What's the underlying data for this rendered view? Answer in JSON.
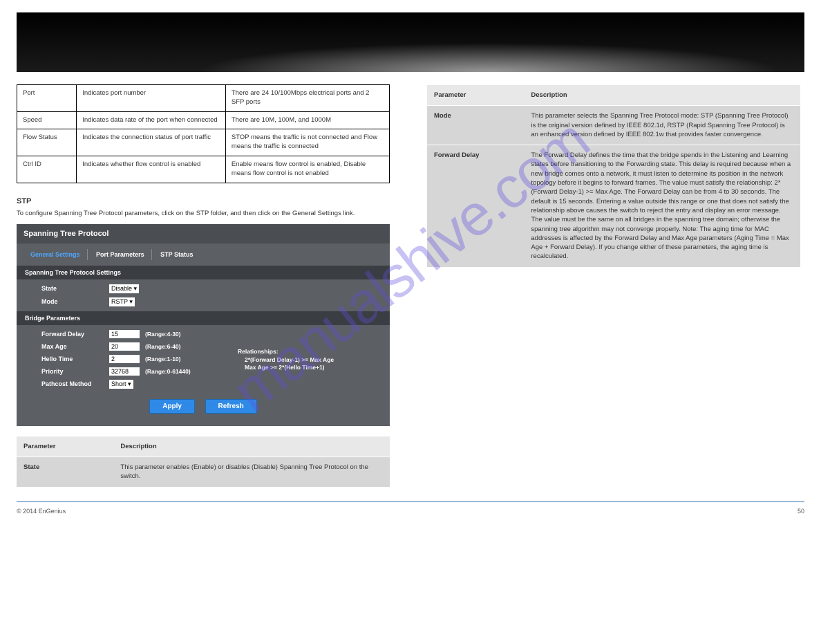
{
  "watermark": "manualshive.com",
  "left": {
    "table1": [
      [
        "Port",
        "Indicates port number",
        "There are 24 10/100Mbps electrical ports and 2 SFP ports"
      ],
      [
        "Speed",
        "Indicates data rate of the port when connected",
        "There are 10M, 100M, and 1000M"
      ],
      [
        "Flow Status",
        "Indicates the connection status of port traffic",
        "STOP means the traffic is not connected and Flow means the traffic is connected"
      ],
      [
        "Ctrl ID",
        "Indicates whether flow control is enabled",
        "Enable means flow control is enabled, Disable means flow control is not enabled"
      ]
    ],
    "stp_heading": "STP",
    "stp_intro": "To configure Spanning Tree Protocol parameters, click on the STP folder, and then click on the General Settings link.",
    "shot": {
      "title": "Spanning Tree Protocol",
      "tabs": [
        "General Settings",
        "Port Parameters",
        "STP Status"
      ],
      "sub1": "Spanning Tree Protocol Settings",
      "state_label": "State",
      "state_value": "Disable ▾",
      "mode_label": "Mode",
      "mode_value": "RSTP  ▾",
      "sub2": "Bridge Parameters",
      "rows": [
        {
          "label": "Forward Delay",
          "val": "15",
          "hint": "(Range:4-30)"
        },
        {
          "label": "Max Age",
          "val": "20",
          "hint": "(Range:6-40)"
        },
        {
          "label": "Hello Time",
          "val": "2",
          "hint": "(Range:1-10)"
        },
        {
          "label": "Priority",
          "val": "32768",
          "hint": "(Range:0-61440)"
        }
      ],
      "path_label": "Pathcost Method",
      "path_val": "Short  ▾",
      "rels_title": "Relationships:",
      "rels1": "2*(Forward Delay-1) >= Max Age",
      "rels2": "Max Age >= 2*(Hello Time+1)",
      "apply": "Apply",
      "refresh": "Refresh"
    },
    "table2": {
      "h1": "Parameter",
      "h2": "Description",
      "r1a": "State",
      "r1b": "This parameter enables (Enable) or disables (Disable) Spanning Tree Protocol on the switch."
    }
  },
  "right": {
    "table1": {
      "h1": "Parameter",
      "h2": "Description",
      "rows": [
        [
          "Mode",
          "This parameter selects the Spanning Tree Protocol mode: STP (Spanning Tree Protocol) is the original version defined by IEEE 802.1d, RSTP (Rapid Spanning Tree Protocol) is an enhanced version defined by IEEE 802.1w that provides faster convergence."
        ],
        [
          "Forward Delay",
          "The Forward Delay defines the time that the bridge spends in the Listening and Learning states before transitioning to the Forwarding state. This delay is required because when a new bridge comes onto a network, it must listen to determine its position in the network topology before it begins to forward frames. The value must satisfy the relationship: 2*(Forward Delay-1) >= Max Age. The Forward Delay can be from 4 to 30 seconds. The default is 15 seconds. Entering a value outside this range or one that does not satisfy the relationship above causes the switch to reject the entry and display an error message. The value must be the same on all bridges in the spanning tree domain; otherwise the spanning tree algorithm may not converge properly. Note: The aging time for MAC addresses is affected by the Forward Delay and Max Age parameters (Aging Time = Max Age + Forward Delay). If you change either of these parameters, the aging time is recalculated."
        ]
      ]
    }
  },
  "footer": {
    "left": "© 2014 EnGenius",
    "right": "50"
  }
}
